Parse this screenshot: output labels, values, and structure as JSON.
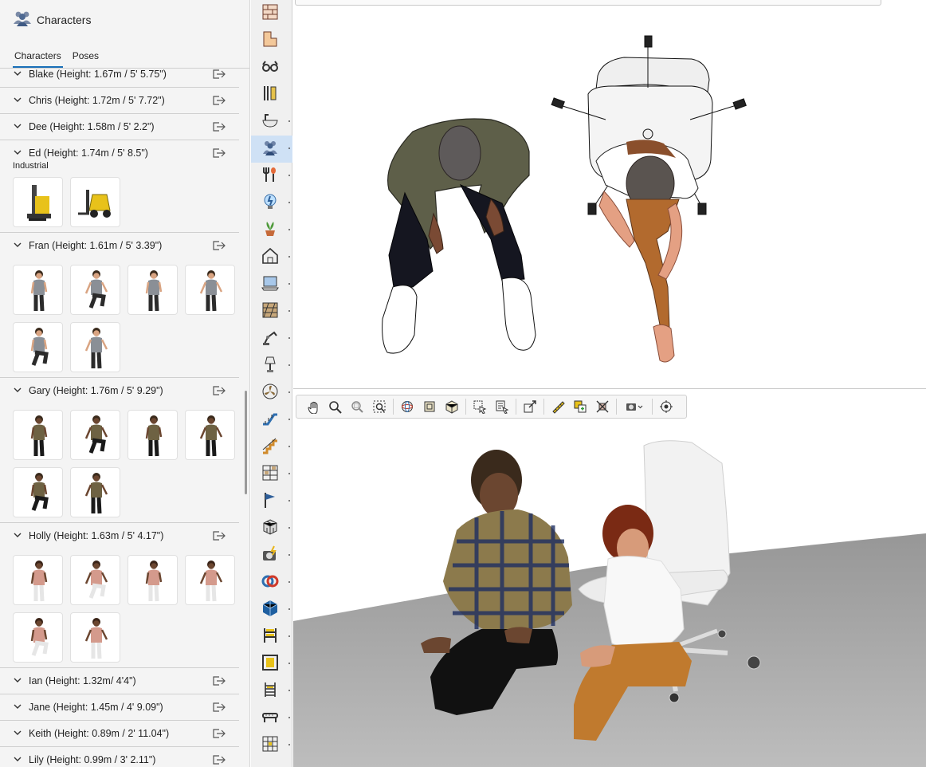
{
  "panel": {
    "title": "Characters",
    "tabs": [
      {
        "label": "Characters",
        "active": true
      },
      {
        "label": "Poses",
        "active": false
      }
    ]
  },
  "sections": [
    {
      "label": "Blake (Height: 1.67m / 5' 5.75\")",
      "thumbs": 0
    },
    {
      "label": "Chris (Height: 1.72m / 5' 7.72\")",
      "thumbs": 0
    },
    {
      "label": "Dee (Height: 1.58m / 5' 2.2\")",
      "thumbs": 0
    },
    {
      "label": "Ed (Height: 1.74m / 5' 8.5\")",
      "sublabel": "Industrial",
      "thumbs": 2,
      "kind": "forklift"
    },
    {
      "label": "Fran (Height: 1.61m / 5' 3.39\")",
      "thumbs": 6,
      "kind": "fran"
    },
    {
      "label": "Gary (Height: 1.76m / 5' 9.29\")",
      "thumbs": 6,
      "kind": "gary"
    },
    {
      "label": "Holly (Height: 1.63m / 5' 4.17\")",
      "thumbs": 6,
      "kind": "holly"
    },
    {
      "label": "Ian (Height: 1.32m/ 4'4\")",
      "thumbs": 0
    },
    {
      "label": "Jane (Height: 1.45m / 4' 9.09\")",
      "thumbs": 0
    },
    {
      "label": "Keith (Height: 0.89m / 2' 11.04\")",
      "thumbs": 0
    },
    {
      "label": "Lily (Height: 0.99m / 3' 2.11\")",
      "thumbs": 0
    }
  ],
  "toolbar_icons": [
    "wall-icon",
    "floor-plan-icon",
    "glasses-icon",
    "measure-icon",
    "bathroom-icon",
    "characters-icon",
    "kitchen-icon",
    "lighting-icon",
    "plants-icon",
    "house-icon",
    "laptop-icon",
    "brick-icon",
    "robot-arm-icon",
    "lamp-icon",
    "fan-icon",
    "escalator-icon",
    "stairs-icon",
    "shelving-icon",
    "flag-icon",
    "cube-icon",
    "camera-flash-icon",
    "rings-icon",
    "sketchup-icon",
    "pallet-rack-icon",
    "frame-icon",
    "ladder-icon",
    "conveyor-icon",
    "storage-rack-icon"
  ],
  "view_toolbar_icons": [
    "hand-pan-icon",
    "zoom-icon",
    "zoom-window-icon",
    "zoom-extents-icon",
    "sep",
    "orbit-icon",
    "front-view-icon",
    "iso-view-icon",
    "sep",
    "select-icon",
    "select-list-icon",
    "sep",
    "scale-icon",
    "sep",
    "tape-measure-icon",
    "copy-icon",
    "delete-icon",
    "sep",
    "camera-dropdown-icon",
    "sep",
    "target-icon"
  ],
  "colors": {
    "accent": "#1a6fb8",
    "selected_tool": "#cfe1f5",
    "panel_bg": "#f4f4f4",
    "floor": "#8a8a8a"
  }
}
